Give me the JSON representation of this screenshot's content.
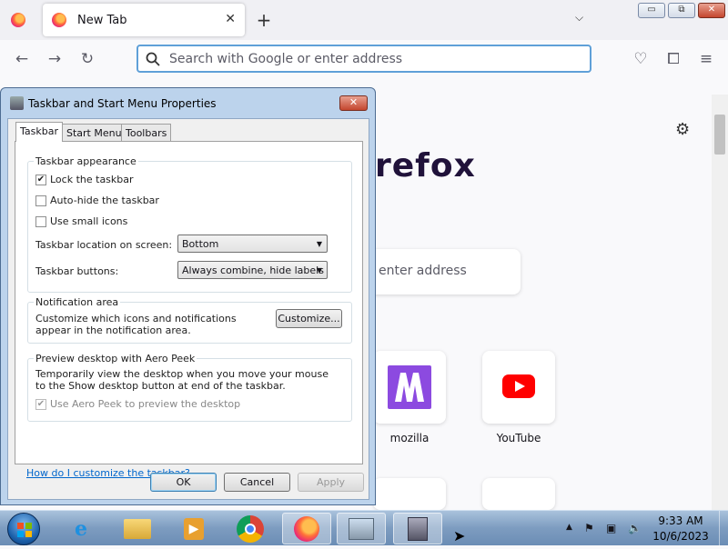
{
  "browser": {
    "tab": {
      "label": "New Tab",
      "close": "✕"
    },
    "new_tab_glyph": "+",
    "tab_list_glyph": "⌵",
    "window_controls": {
      "min": "▭",
      "max": "⧉",
      "close": "✕"
    },
    "url_placeholder": "Search with Google or enter address",
    "brand_partial": "refox",
    "search_partial": "enter address",
    "tiles": [
      {
        "label": "mozilla",
        "icon": "mozilla-m-icon"
      },
      {
        "label": "YouTube",
        "icon": "youtube-play-icon"
      }
    ]
  },
  "dialog": {
    "title": "Taskbar and Start Menu Properties",
    "close": "✕",
    "tabs": [
      "Taskbar",
      "Start Menu",
      "Toolbars"
    ],
    "appearance": {
      "title": "Taskbar appearance",
      "lock": {
        "label": "Lock the taskbar",
        "checked": true
      },
      "autohide": {
        "label": "Auto-hide the taskbar",
        "checked": false
      },
      "small_icons": {
        "label": "Use small icons",
        "checked": false
      },
      "location_label": "Taskbar location on screen:",
      "location_value": "Bottom",
      "buttons_label": "Taskbar buttons:",
      "buttons_value": "Always combine, hide labels"
    },
    "notification": {
      "title": "Notification area",
      "text": "Customize which icons and notifications appear in the notification area.",
      "button": "Customize..."
    },
    "peek": {
      "title": "Preview desktop with Aero Peek",
      "text": "Temporarily view the desktop when you move your mouse to the Show desktop button at end of the taskbar.",
      "checkbox": {
        "label": "Use Aero Peek to preview the desktop",
        "checked": true,
        "disabled": true
      }
    },
    "help_link": "How do I customize the taskbar?",
    "ok": "OK",
    "cancel": "Cancel",
    "apply": "Apply"
  },
  "taskbar": {
    "time": "9:33 AM",
    "date": "10/6/2023",
    "tray_arrow": "▲"
  }
}
